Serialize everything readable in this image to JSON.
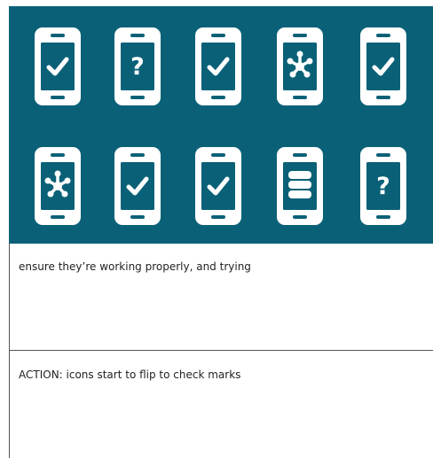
{
  "colors": {
    "panel_background": "#0a6177",
    "icon_color": "#ffffff"
  },
  "icons": {
    "row1": [
      "phone-check-icon",
      "phone-question-icon",
      "phone-check-icon",
      "phone-network-icon",
      "phone-check-icon"
    ],
    "row2": [
      "phone-network-icon",
      "phone-check-icon",
      "phone-check-icon",
      "phone-database-icon",
      "phone-question-icon"
    ]
  },
  "panels": [
    {
      "text": "ensure they’re working properly, and trying"
    },
    {
      "text": "ACTION: icons start to flip to check marks"
    }
  ]
}
